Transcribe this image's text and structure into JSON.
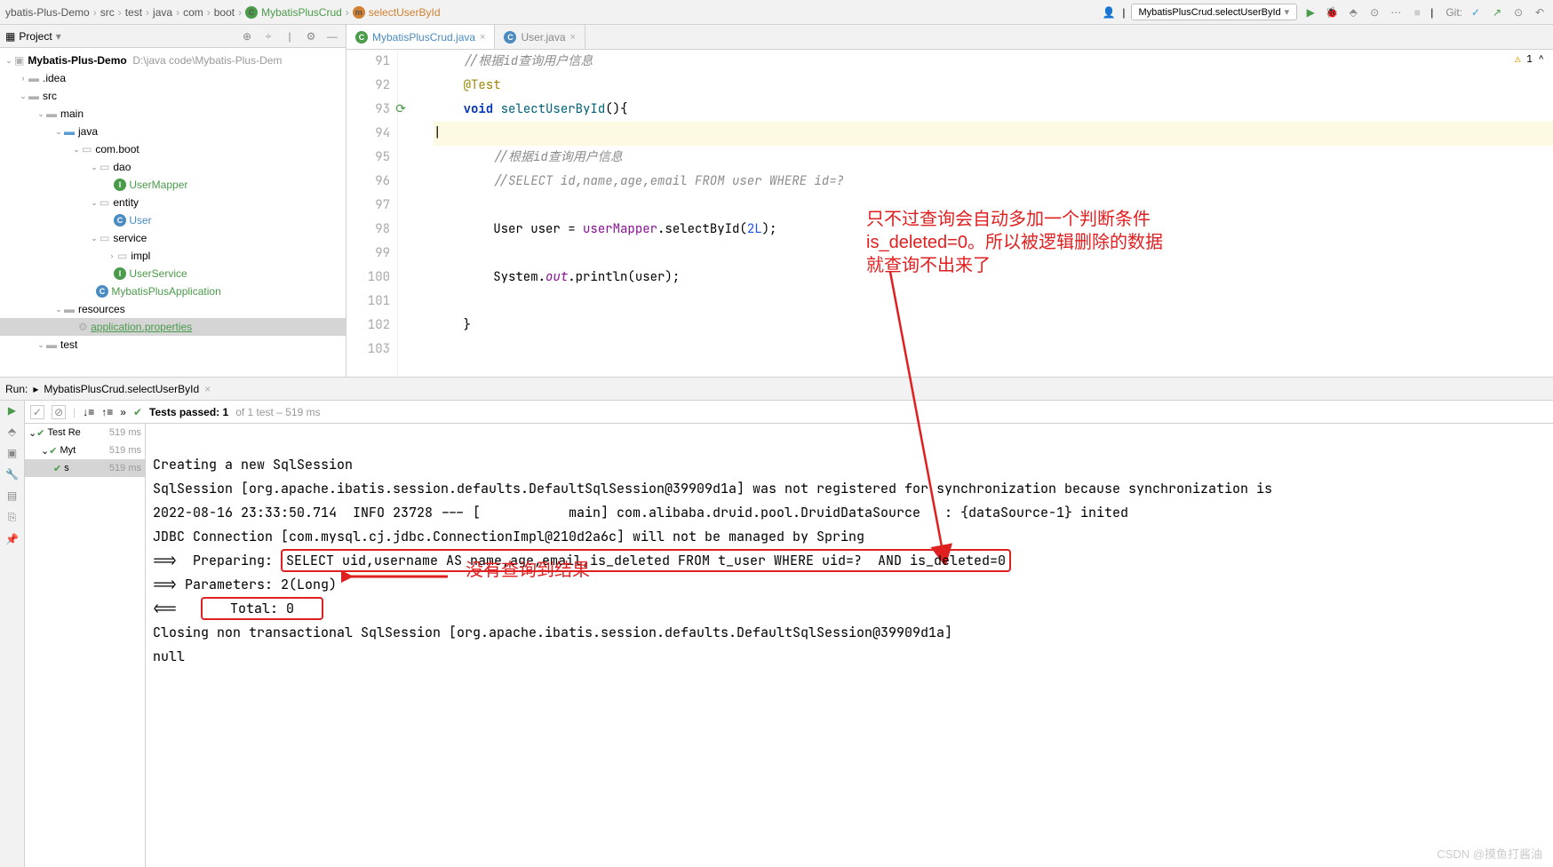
{
  "breadcrumb": [
    "ybatis-Plus-Demo",
    "src",
    "test",
    "java",
    "com",
    "boot"
  ],
  "breadcrumb_class": "MybatisPlusCrud",
  "breadcrumb_method": "selectUserById",
  "run_config": "MybatisPlusCrud.selectUserById",
  "git_label": "Git:",
  "project_panel_title": "Project",
  "tree": {
    "root": "Mybatis-Plus-Demo",
    "root_path": "D:\\java code\\Mybatis-Plus-Dem",
    "idea": ".idea",
    "src": "src",
    "main": "main",
    "java": "java",
    "comboot": "com.boot",
    "dao": "dao",
    "usermapper": "UserMapper",
    "entity": "entity",
    "user": "User",
    "service": "service",
    "impl": "impl",
    "userservice": "UserService",
    "app": "MybatisPlusApplication",
    "resources": "resources",
    "appprops": "application.properties",
    "test": "test"
  },
  "tabs": {
    "t1": "MybatisPlusCrud.java",
    "t2": "User.java"
  },
  "code": {
    "l91": "//根据id查询用户信息",
    "l92": "@Test",
    "l93_kw": "void",
    "l93_m": "selectUserById",
    "l95": "//根据id查询用户信息",
    "l96": "//SELECT id,name,age,email FROM user WHERE id=?",
    "l98a": "User user = ",
    "l98b": "userMapper",
    "l98c": ".selectById(",
    "l98d": "2L",
    "l100a": "System.",
    "l100b": "out",
    "l100c": ".println(user);"
  },
  "lines": [
    "91",
    "92",
    "93",
    "94",
    "95",
    "96",
    "97",
    "98",
    "99",
    "100",
    "101",
    "102",
    "103"
  ],
  "warn_count": "1",
  "ann1": "只不过查询会自动多加一个判断条件\nis_deleted=0。所以被逻辑删除的数据\n就查询不出来了",
  "ann2": "没有查询到结果",
  "run_tab": "MybatisPlusCrud.selectUserById",
  "run_label": "Run:",
  "tests_passed": "Tests passed: 1",
  "tests_total": " of 1 test – 519 ms",
  "test_rows": {
    "r1": "Test Re",
    "t1": "519 ms",
    "r2": "Myt",
    "t2": "519 ms",
    "r3": "s",
    "t3": "519 ms"
  },
  "console": {
    "l1": "Creating a new SqlSession",
    "l2": "SqlSession [org.apache.ibatis.session.defaults.DefaultSqlSession@39909d1a] was not registered for synchronization because synchronization is",
    "l3": "2022-08-16 23:33:50.714  INFO 23728 --- [           main] com.alibaba.druid.pool.DruidDataSource   : {dataSource-1} inited",
    "l4": "JDBC Connection [com.mysql.cj.jdbc.ConnectionImpl@210d2a6c] will not be managed by Spring",
    "l5a": "==>  Preparing: ",
    "l5b": "SELECT uid,username AS name,age,email,is_deleted FROM t_user WHERE uid=?  AND is_deleted=0",
    "l6": "==> Parameters: 2(Long)",
    "l7a": "<==   ",
    "l7b": "   Total: 0   ",
    "l8": "Closing non transactional SqlSession [org.apache.ibatis.session.defaults.DefaultSqlSession@39909d1a]",
    "l9": "null"
  },
  "watermark": "CSDN @摸鱼打酱油"
}
